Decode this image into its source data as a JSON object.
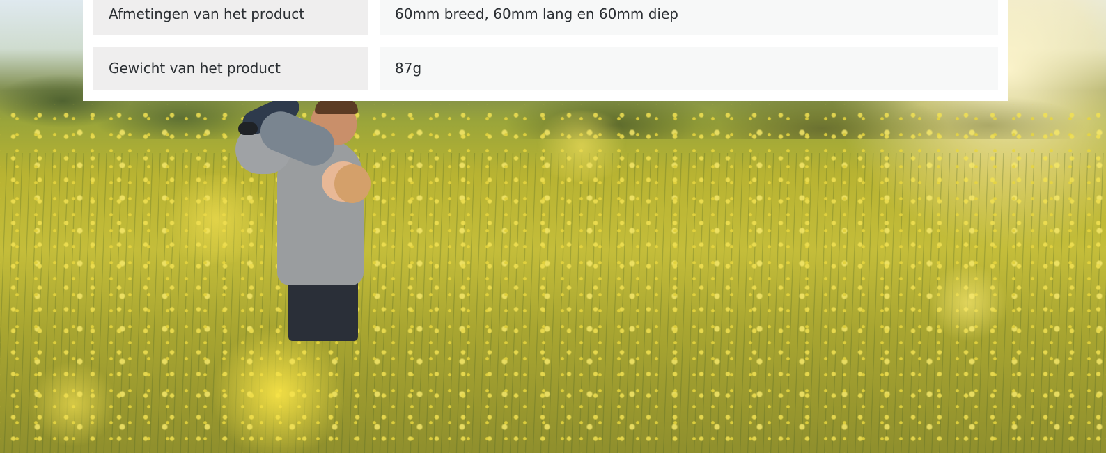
{
  "specs": {
    "rows": [
      {
        "label": "Afmetingen van het product",
        "value": "60mm breed, 60mm lang en 60mm diep"
      },
      {
        "label": "Gewicht van het product",
        "value": "87g"
      }
    ]
  },
  "colors": {
    "card_background": "#ffffff",
    "label_cell": "#efeeee",
    "value_cell": "#f7f8f8",
    "text": "#2b2f33",
    "field_yellow": "#c4bd3a"
  }
}
